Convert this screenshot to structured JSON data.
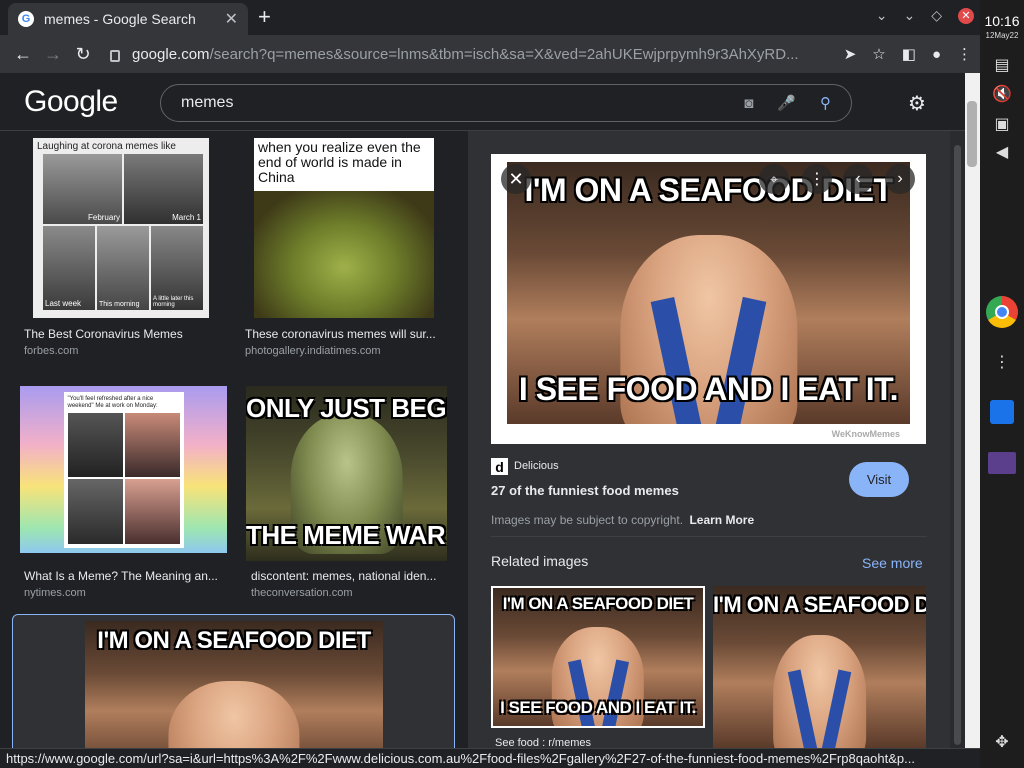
{
  "tab": {
    "title": "memes - Google Search",
    "favicon": "google-g-icon"
  },
  "toolbar": {
    "url_host": "google.com",
    "url_rest": "/search?q=memes&source=lnms&tbm=isch&sa=X&ved=2ahUKEwjprpymh9r3AhXyRD..."
  },
  "google": {
    "logo": "Google",
    "query": "memes"
  },
  "results": [
    {
      "caption": "The Best Coronavirus Memes",
      "source": "forbes.com",
      "text": "Laughing at corona memes like",
      "labels": [
        "February",
        "March 1",
        "Last week",
        "This morning",
        "A little later this morning"
      ]
    },
    {
      "caption": "These coronavirus memes will sur...",
      "source": "photogallery.indiatimes.com",
      "text": "when you realize even the end of world is made in China"
    },
    {
      "caption": "What Is a Meme? The Meaning an...",
      "source": "nytimes.com",
      "text": "\"You'll feel refreshed after a nice weekend\" Me at work on Monday:"
    },
    {
      "caption": "discontent: memes, national iden...",
      "source": "theconversation.com",
      "top": "ONLY JUST BEGU",
      "bottom": "THE MEME WAR HA"
    },
    {
      "top": "I'M ON A SEAFOOD DIET"
    }
  ],
  "panel": {
    "meme_top": "I'M ON A SEAFOOD DIET",
    "meme_bottom": "I SEE FOOD AND I EAT IT.",
    "watermark": "WeKnowMemes",
    "site_letter": "d",
    "site": "Delicious",
    "title": "27 of the funniest food memes",
    "visit": "Visit",
    "copyright": "Images may be subject to copyright.",
    "learn_more": "Learn More",
    "related": "Related images",
    "see_more": "See more",
    "related_items": [
      {
        "top": "I'M ON A SEAFOOD DIET",
        "bottom": "I SEE FOOD AND I EAT IT.",
        "caption": "See food : r/memes"
      },
      {
        "top": "I'M ON A SEAFOOD DIET",
        "bottom": ""
      }
    ]
  },
  "status_url": "https://www.google.com/url?sa=i&url=https%3A%2F%2Fwww.delicious.com.au%2Ffood-files%2Fgallery%2F27-of-the-funniest-food-memes%2Frp8qaoht&p...",
  "system": {
    "time": "10:16",
    "date": "12May22"
  }
}
